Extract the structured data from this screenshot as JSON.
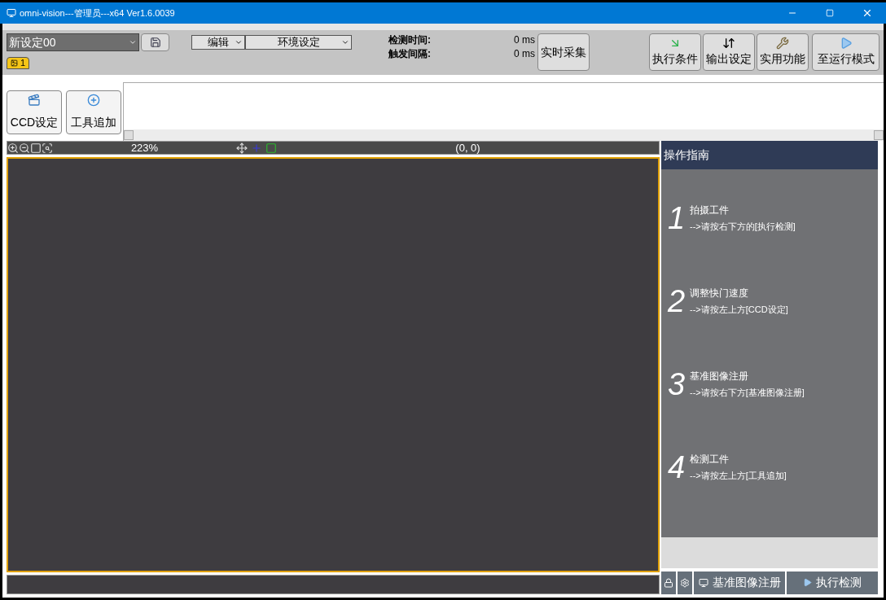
{
  "window": {
    "title": "omni-vision---管理员---x64 Ver1.6.0039"
  },
  "toolbar": {
    "setting_name": "新设定00",
    "menus": [
      "编辑",
      "环境设定"
    ],
    "timing": [
      {
        "label": "检测时间:",
        "value": "0 ms"
      },
      {
        "label": "触发间隔:",
        "value": "0 ms"
      }
    ],
    "live_button": "实时采集",
    "right_buttons": [
      {
        "label": "执行条件",
        "kind": "condition"
      },
      {
        "label": "输出设定",
        "kind": "output"
      },
      {
        "label": "实用功能",
        "kind": "tools"
      },
      {
        "label": "至运行模式",
        "kind": "run"
      }
    ],
    "tabs": [
      {
        "label": "1",
        "selected": true
      }
    ]
  },
  "tool_buttons": [
    {
      "label": "CCD设定",
      "kind": "camera"
    },
    {
      "label": "工具追加",
      "kind": "add"
    }
  ],
  "viewer": {
    "zoom": "223%",
    "coords": "(0, 0)"
  },
  "guide": {
    "title": "操作指南",
    "steps": [
      {
        "number": "1",
        "title": "拍摄工件",
        "hint": "-->请按右下方的[执行检测]"
      },
      {
        "number": "2",
        "title": "调整快门速度",
        "hint": "-->请按左上方[CCD设定]"
      },
      {
        "number": "3",
        "title": "基准图像注册",
        "hint": "-->请按右下方[基准图像注册]"
      },
      {
        "number": "4",
        "title": "检测工件",
        "hint": "-->请按左上方[工具追加]"
      }
    ]
  },
  "bottom_buttons": [
    {
      "label": "基准图像注册",
      "kind": "register"
    },
    {
      "label": "执行检测",
      "kind": "run"
    }
  ]
}
